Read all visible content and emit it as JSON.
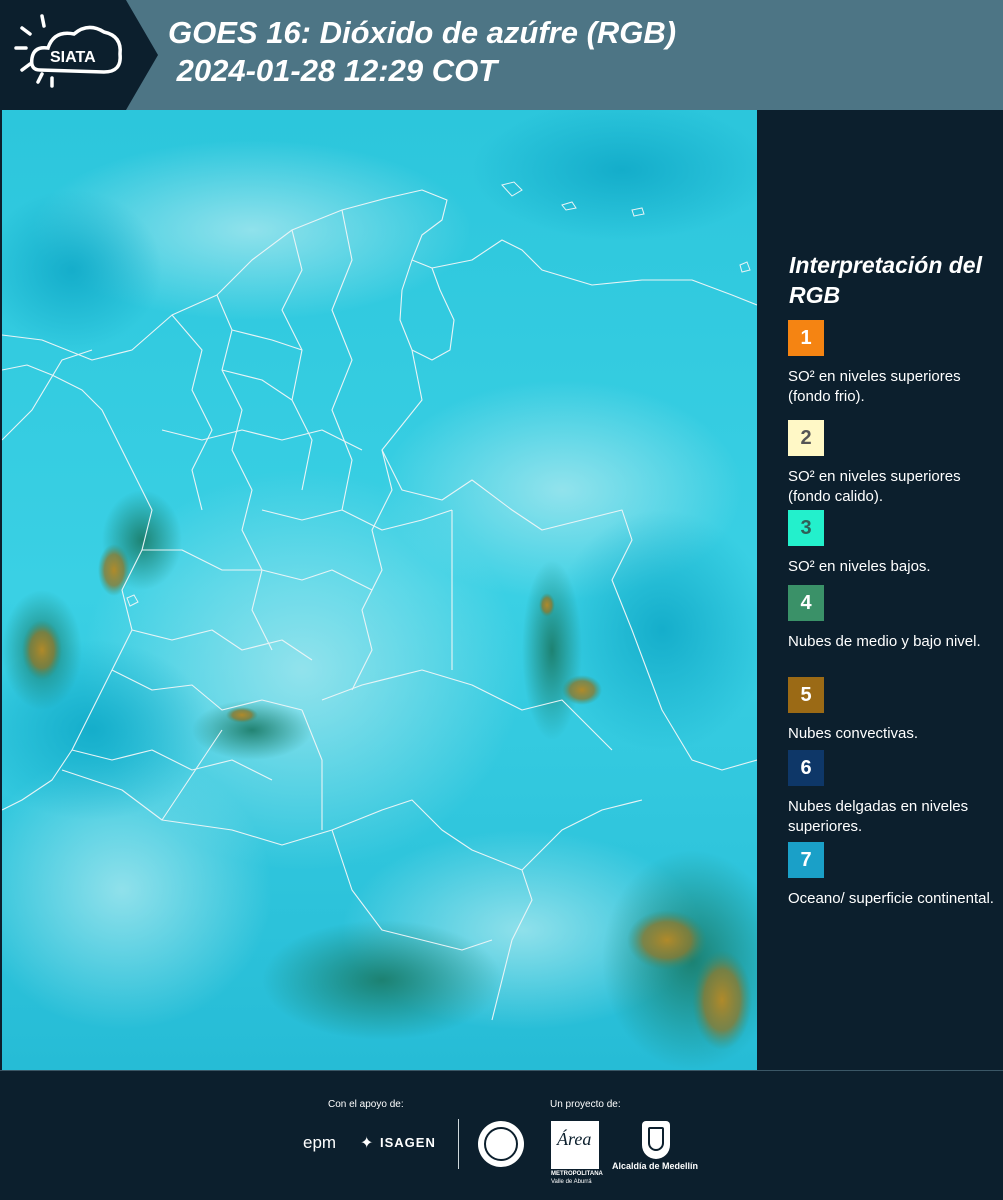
{
  "header": {
    "logo_text": "SIATA",
    "title_line1": "GOES 16: Dióxido de azúfre (RGB)",
    "title_line2": " 2024-01-28 12:29 COT"
  },
  "legend": {
    "title": "Interpretación del RGB",
    "items": [
      {
        "number": "1",
        "color": "#f58412",
        "text_color": "#ffffff",
        "label": "SO² en niveles superiores (fondo frio)."
      },
      {
        "number": "2",
        "color": "#fff8c6",
        "text_color": "#555555",
        "label": "SO² en niveles superiores (fondo calido)."
      },
      {
        "number": "3",
        "color": "#23f0cc",
        "text_color": "#2f5f57",
        "label": "SO² en niveles bajos."
      },
      {
        "number": "4",
        "color": "#3a9168",
        "text_color": "#ffffff",
        "label": "Nubes de medio y bajo nivel."
      },
      {
        "number": "5",
        "color": "#9b6a15",
        "text_color": "#ffffff",
        "label": "Nubes convectivas."
      },
      {
        "number": "6",
        "color": "#0e3768",
        "text_color": "#ffffff",
        "label": "Nubes delgadas en niveles superiores."
      },
      {
        "number": "7",
        "color": "#1aa0c8",
        "text_color": "#ffffff",
        "label": "Oceano/ superficie continental."
      }
    ]
  },
  "footer": {
    "support_label": "Con el apoyo de:",
    "project_label": "Un proyecto de:",
    "sponsor_epm": "epm",
    "sponsor_isagen": "ISAGEN",
    "partner_area_line1": "METROPOLITANA",
    "partner_area_line2": "Valle de Aburrá",
    "partner_alcaldia": "Alcaldía de Medellín"
  },
  "colors": {
    "header_bg": "#4d7585",
    "logo_bg": "#0c1f2d",
    "panel_bg": "#0c1f2d",
    "map_cyan": "#1fc9e3"
  }
}
